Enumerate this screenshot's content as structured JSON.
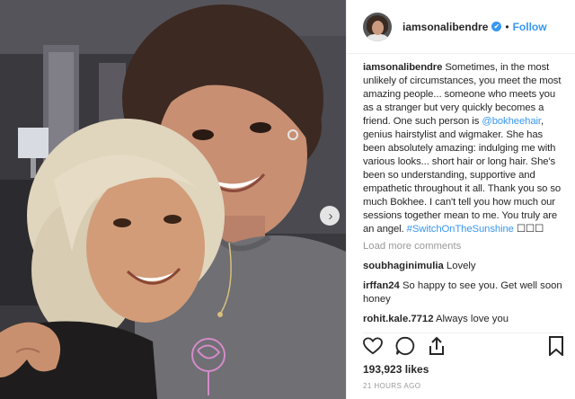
{
  "header": {
    "username": "iamsonalibendre",
    "verified_badge": "✔",
    "separator": "•",
    "follow_label": "Follow"
  },
  "photo": {
    "next_icon": "›"
  },
  "caption": {
    "username": "iamsonalibendre",
    "text_1": "Sometimes, in the most unlikely of circumstances, you meet the most amazing people... someone who meets you as a stranger but very quickly becomes a friend. One such person is",
    "mention": "@bokheehair",
    "text_2": ", genius hairstylist and wigmaker. She has been absolutely amazing: indulging me with various looks... short hair or long hair. She's been so understanding, supportive and empathetic throughout it all. Thank you so so much Bokhee. I can't tell you how much our sessions together mean to me. You truly are an angel.",
    "hashtag": "#SwitchOnTheSunshine",
    "emoji": "☐☐☐"
  },
  "load_more": "Load more comments",
  "comments": [
    {
      "user": "soubhaginimulia",
      "text": "Lovely"
    },
    {
      "user": "irffan24",
      "text": "So happy to see you. Get well soon honey"
    },
    {
      "user": "rohit.kale.7712",
      "text": "Always love you"
    }
  ],
  "likes": "193,923 likes",
  "timestamp": "21 HOURS AGO",
  "icons": {
    "like": "heart-icon",
    "comment": "comment-icon",
    "share": "share-icon",
    "save": "bookmark-icon"
  },
  "colors": {
    "link_blue": "#3897f0",
    "text": "#262626",
    "muted": "#999999"
  }
}
